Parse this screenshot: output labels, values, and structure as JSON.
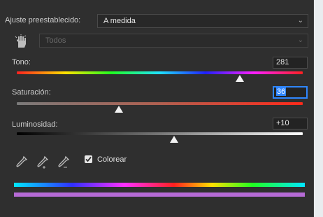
{
  "preset": {
    "label": "Ajuste preestablecido:",
    "value": "A medida"
  },
  "channel": {
    "value": "Todos"
  },
  "hue": {
    "label": "Tono:",
    "value": "281",
    "slider_fraction": 0.77
  },
  "saturation": {
    "label": "Saturación:",
    "value": "36",
    "slider_fraction": 0.36
  },
  "lightness": {
    "label": "Luminosidad:",
    "value": "+10",
    "slider_fraction": 0.55
  },
  "colorize": {
    "label": "Colorear",
    "checked": true
  },
  "icons": [
    "hand-target-icon",
    "eyedropper-icon",
    "eyedropper-plus-icon",
    "eyedropper-minus-icon",
    "chevron-down-icon",
    "check-icon"
  ],
  "colors": {
    "panel_bg": "#2f2f2f",
    "accent": "#2f86ff",
    "result_bar": "#b66bd6"
  }
}
